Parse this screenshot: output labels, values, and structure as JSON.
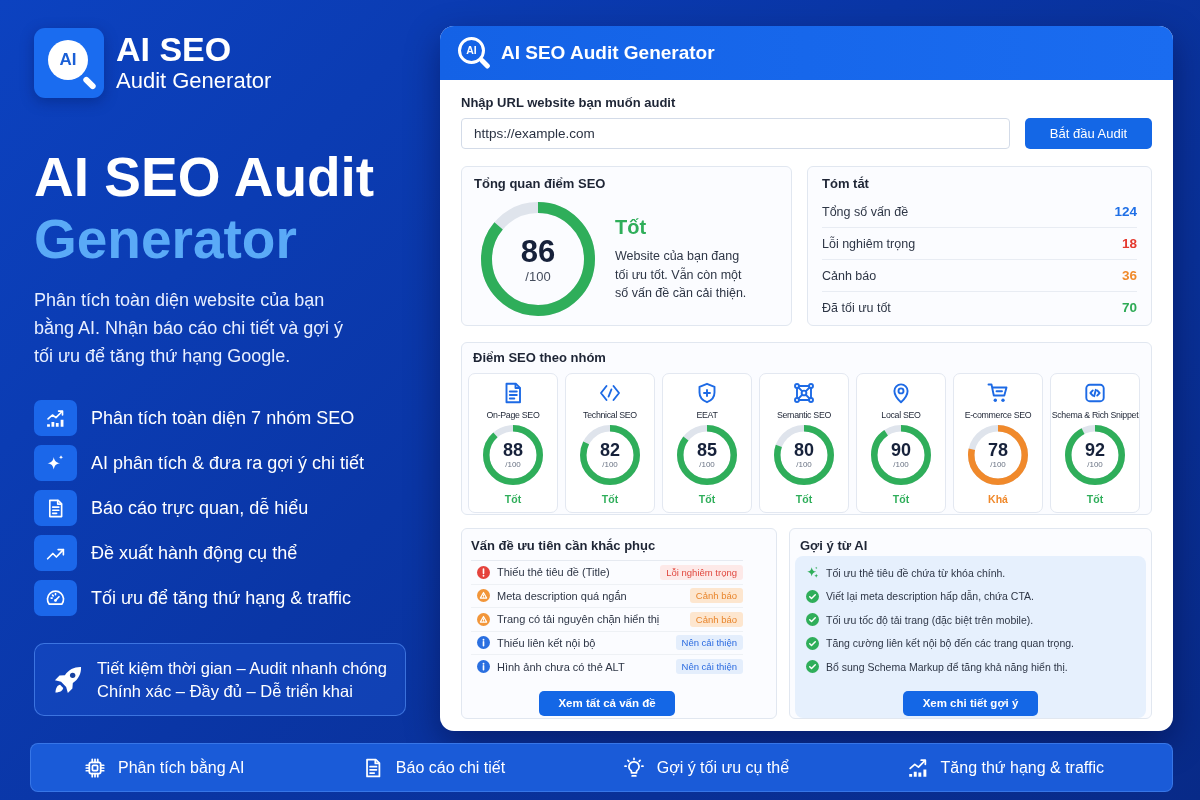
{
  "brand": {
    "logo_mark": "AI",
    "title": "AI SEO",
    "subtitle": "Audit Generator"
  },
  "hero": {
    "title": "AI SEO Audit",
    "title_accent": "Generator",
    "description": "Phân tích toàn diện website của bạn bằng AI. Nhận báo cáo chi tiết và gợi ý tối ưu để tăng thứ hạng Google."
  },
  "features": [
    {
      "label": "Phân tích toàn diện 7 nhóm SEO"
    },
    {
      "label": "AI phân tích & đưa ra gợi ý chi tiết"
    },
    {
      "label": "Báo cáo trực quan, dễ hiểu"
    },
    {
      "label": "Đề xuất hành động cụ thể"
    },
    {
      "label": "Tối ưu để tăng thứ hạng & traffic"
    }
  ],
  "callout": {
    "lines": [
      "Tiết kiệm thời gian – Audit nhanh chóng",
      "Chính xác – Đầy đủ – Dễ triển khai"
    ]
  },
  "window": {
    "logo_mark": "AI",
    "title": "AI SEO Audit Generator"
  },
  "url_form": {
    "label": "Nhập URL website bạn muốn audit",
    "value": "https://example.com",
    "button": "Bắt đầu Audit"
  },
  "overview": {
    "title": "Tổng quan điểm SEO",
    "score": "86",
    "max": "/100",
    "level": 0.86,
    "kind": "good",
    "rating": "Tốt",
    "description": "Website của bạn đang tối ưu tốt. Vẫn còn một số vấn đề cần cải thiện."
  },
  "summary": {
    "title": "Tóm tắt",
    "rows": [
      {
        "label": "Tổng số vấn đề",
        "value": "124",
        "color": "#1f6fe6"
      },
      {
        "label": "Lỗi nghiêm trọng",
        "value": "18",
        "color": "#e5392f"
      },
      {
        "label": "Cảnh báo",
        "value": "36",
        "color": "#f08a2b"
      },
      {
        "label": "Đã tối ưu tốt",
        "value": "70",
        "color": "#2eaa55"
      }
    ]
  },
  "categories": {
    "title": "Điểm SEO theo nhóm",
    "items": [
      {
        "name": "On-Page SEO",
        "score": "88",
        "max": "/100",
        "level": 0.88,
        "rating": "Tốt",
        "kind": "good"
      },
      {
        "name": "Technical SEO",
        "score": "82",
        "max": "/100",
        "level": 0.82,
        "rating": "Tốt",
        "kind": "good"
      },
      {
        "name": "EEAT",
        "score": "85",
        "max": "/100",
        "level": 0.85,
        "rating": "Tốt",
        "kind": "good"
      },
      {
        "name": "Semantic SEO",
        "score": "80",
        "max": "/100",
        "level": 0.8,
        "rating": "Tốt",
        "kind": "good"
      },
      {
        "name": "Local SEO",
        "score": "90",
        "max": "/100",
        "level": 0.9,
        "rating": "Tốt",
        "kind": "good"
      },
      {
        "name": "E-commerce SEO",
        "score": "78",
        "max": "/100",
        "level": 0.78,
        "rating": "Khá",
        "kind": "fair"
      },
      {
        "name": "Schema & Rich Snippet",
        "score": "92",
        "max": "/100",
        "level": 0.92,
        "rating": "Tốt",
        "kind": "good"
      }
    ]
  },
  "issues": {
    "title": "Vấn đề ưu tiên cần khắc phục",
    "items": [
      {
        "kind": "critical",
        "text": "Thiếu thẻ tiêu đề (Title)",
        "badge": "Lỗi nghiêm trọng"
      },
      {
        "kind": "warning",
        "text": "Meta description quá ngắn",
        "badge": "Cảnh báo"
      },
      {
        "kind": "warning",
        "text": "Trang có tải nguyên chặn hiển thị",
        "badge": "Cảnh báo"
      },
      {
        "kind": "info",
        "text": "Thiếu liên kết nội bộ",
        "badge": "Nên cải thiện"
      },
      {
        "kind": "info",
        "text": "Hình ảnh chưa có thẻ ALT",
        "badge": "Nên cải thiện"
      }
    ],
    "button": "Xem tất cả vấn đề"
  },
  "suggestions": {
    "title": "Gợi ý từ AI",
    "items": [
      {
        "kind": "ai",
        "text": "Tối ưu thẻ tiêu đề chứa từ khóa chính."
      },
      {
        "kind": "check",
        "text": "Viết lại meta description hấp dẫn, chứa CTA."
      },
      {
        "kind": "check",
        "text": "Tối ưu tốc độ tải trang (đặc biệt trên mobile)."
      },
      {
        "kind": "check",
        "text": "Tăng cường liên kết nội bộ đến các trang quan trọng."
      },
      {
        "kind": "check",
        "text": "Bổ sung Schema Markup để tăng khả năng hiển thị."
      }
    ],
    "button": "Xem chi tiết gợi ý"
  },
  "bottom_bar": {
    "items": [
      {
        "label": "Phân tích bằng AI"
      },
      {
        "label": "Báo cáo chi tiết"
      },
      {
        "label": "Gợi ý tối ưu cụ thể"
      },
      {
        "label": "Tăng thứ hạng & traffic"
      }
    ]
  }
}
